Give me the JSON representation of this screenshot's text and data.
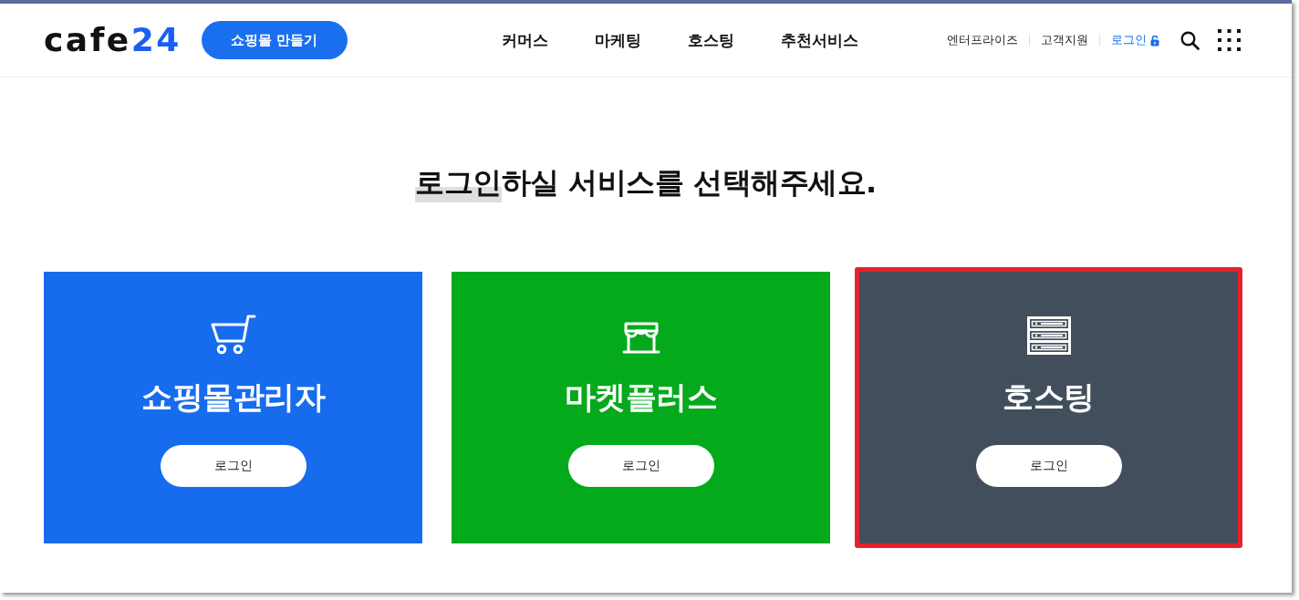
{
  "header": {
    "logo": {
      "text": "cafe",
      "accent": "24"
    },
    "cta_button": "쇼핑몰 만들기",
    "nav": [
      "커머스",
      "마케팅",
      "호스팅",
      "추천서비스"
    ],
    "utility_links": [
      {
        "label": "엔터프라이즈",
        "kind": "plain"
      },
      {
        "label": "고객지원",
        "kind": "plain"
      },
      {
        "label": "로그인",
        "kind": "login"
      }
    ]
  },
  "heading": {
    "parts": [
      {
        "text": "로그인",
        "highlighted": true
      },
      {
        "text": "하실 서비스를 선택해주세요.",
        "highlighted": false
      }
    ]
  },
  "cards": [
    {
      "kind": "cart",
      "title": "쇼핑몰관리자",
      "button": "로그인",
      "color": "#176ced",
      "outlined": false
    },
    {
      "kind": "store",
      "title": "마켓플러스",
      "button": "로그인",
      "color": "#05a91c",
      "outlined": false
    },
    {
      "kind": "server",
      "title": "호스팅",
      "button": "로그인",
      "color": "#434e5d",
      "outlined": true
    }
  ]
}
